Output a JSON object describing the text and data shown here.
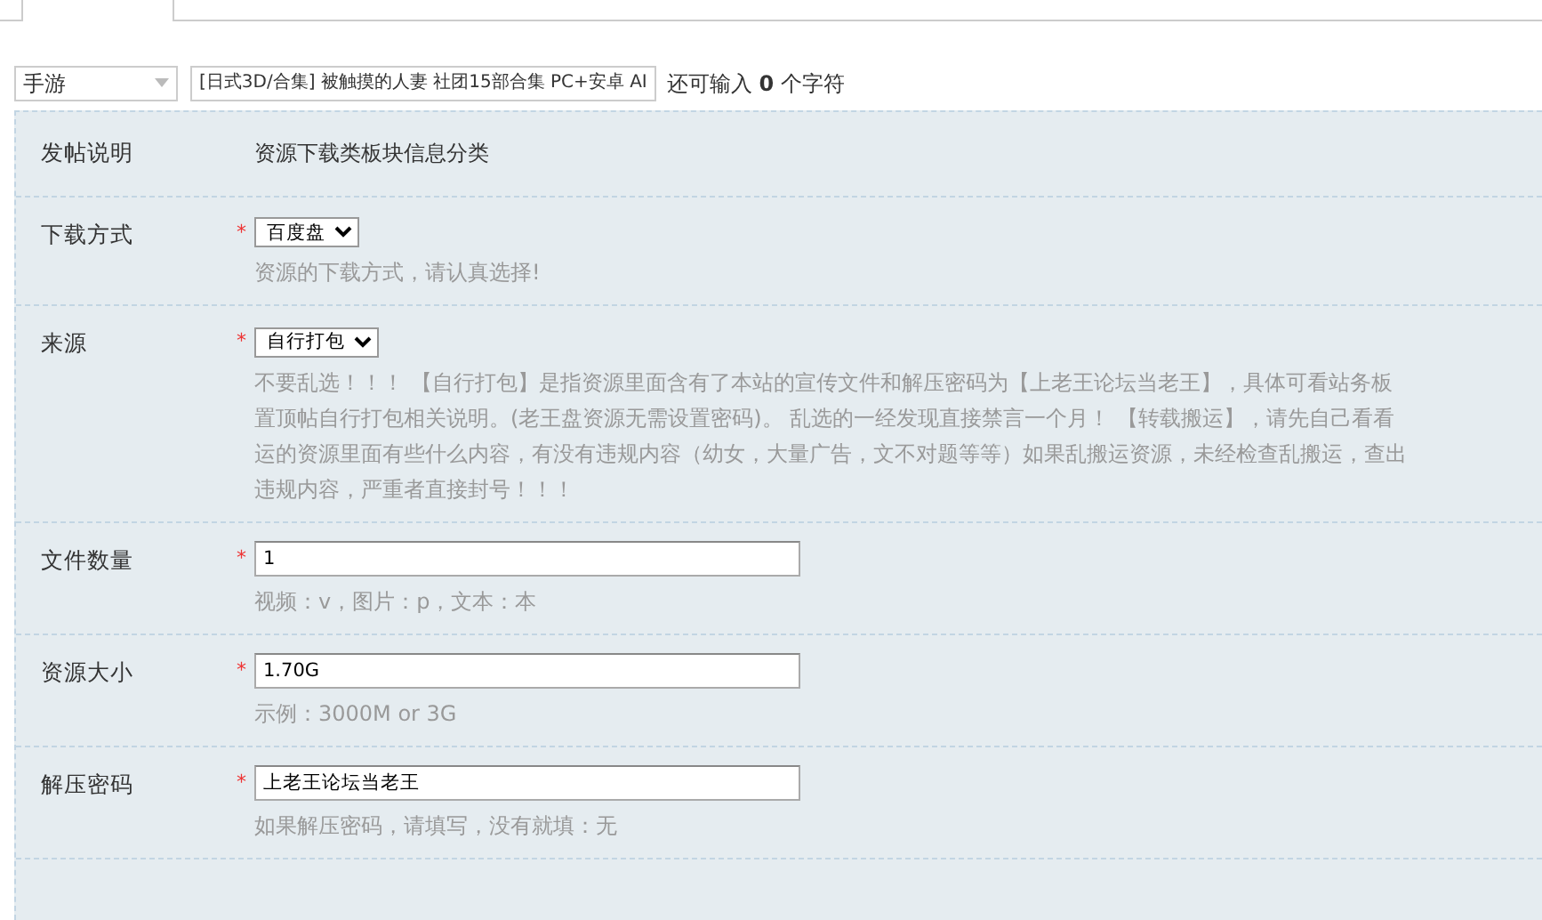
{
  "header": {
    "category": {
      "value": "手游"
    },
    "title": {
      "value": "[日式3D/合集] 被触摸的人妻 社团15部合集 PC+安卓 AI"
    },
    "counter": "还可输入 **0** 个字符"
  },
  "fields": [
    {
      "kind": "text",
      "label": "发帖说明",
      "value": "资源下载类板块信息分类"
    },
    {
      "kind": "select",
      "label": "下载方式",
      "required_mark": "*",
      "value": "百度盘",
      "hint": [
        "资源的下载方式，请认真选择!"
      ]
    },
    {
      "kind": "select",
      "label": "来源",
      "required_mark": "*",
      "value": "自行打包",
      "hint": [
        "不要乱选！！！ 【自行打包】是指资源里面含有了本站的宣传文件和解压密码为【上老王论坛当老王】，具体可看站务板",
        "置顶帖自行打包相关说明。(老王盘资源无需设置密码)。 乱选的一经发现直接禁言一个月！ 【转载搬运】，请先自己看看",
        "运的资源里面有些什么内容，有没有违规内容（幼女，大量广告，文不对题等等）如果乱搬运资源，未经检查乱搬运，查出",
        "违规内容，严重者直接封号！！！"
      ]
    },
    {
      "kind": "input",
      "label": "文件数量",
      "required_mark": "*",
      "value": "1",
      "hint": [
        "视频：v，图片：p，文本：本"
      ]
    },
    {
      "kind": "input",
      "label": "资源大小",
      "required_mark": "*",
      "value": "1.70G",
      "hint": [
        "示例：3000M or 3G"
      ]
    },
    {
      "kind": "input",
      "label": "解压密码",
      "required_mark": "*",
      "value": "上老王论坛当老王",
      "hint": [
        "如果解压密码，请填写，没有就填：无"
      ]
    }
  ]
}
